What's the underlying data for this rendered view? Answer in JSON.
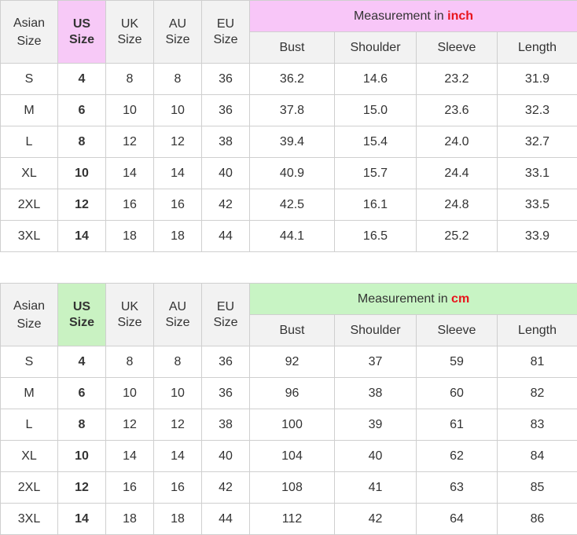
{
  "inch_table": {
    "header": {
      "asian_size": [
        "Asian",
        "Size"
      ],
      "us_size": [
        "US",
        "Size"
      ],
      "uk_size": [
        "UK",
        "Size"
      ],
      "au_size": [
        "AU",
        "Size"
      ],
      "eu_size": [
        "EU",
        "Size"
      ],
      "measurement_prefix": "Measurement in ",
      "measurement_unit": "inch",
      "columns": [
        "Bust",
        "Shoulder",
        "Sleeve",
        "Length"
      ]
    },
    "rows": [
      [
        "S",
        "4",
        "8",
        "8",
        "36",
        "36.2",
        "14.6",
        "23.2",
        "31.9"
      ],
      [
        "M",
        "6",
        "10",
        "10",
        "36",
        "37.8",
        "15.0",
        "23.6",
        "32.3"
      ],
      [
        "L",
        "8",
        "12",
        "12",
        "38",
        "39.4",
        "15.4",
        "24.0",
        "32.7"
      ],
      [
        "XL",
        "10",
        "14",
        "14",
        "40",
        "40.9",
        "15.7",
        "24.4",
        "33.1"
      ],
      [
        "2XL",
        "12",
        "16",
        "16",
        "42",
        "42.5",
        "16.1",
        "24.8",
        "33.5"
      ],
      [
        "3XL",
        "14",
        "18",
        "18",
        "44",
        "44.1",
        "16.5",
        "25.2",
        "33.9"
      ]
    ],
    "accent_color": "#f7c9f7"
  },
  "cm_table": {
    "header": {
      "asian_size": [
        "Asian",
        "Size"
      ],
      "us_size": [
        "US",
        "Size"
      ],
      "uk_size": [
        "UK",
        "Size"
      ],
      "au_size": [
        "AU",
        "Size"
      ],
      "eu_size": [
        "EU",
        "Size"
      ],
      "measurement_prefix": "Measurement in ",
      "measurement_unit": "cm",
      "columns": [
        "Bust",
        "Shoulder",
        "Sleeve",
        "Length"
      ]
    },
    "rows": [
      [
        "S",
        "4",
        "8",
        "8",
        "36",
        "92",
        "37",
        "59",
        "81"
      ],
      [
        "M",
        "6",
        "10",
        "10",
        "36",
        "96",
        "38",
        "60",
        "82"
      ],
      [
        "L",
        "8",
        "12",
        "12",
        "38",
        "100",
        "39",
        "61",
        "83"
      ],
      [
        "XL",
        "10",
        "14",
        "14",
        "40",
        "104",
        "40",
        "62",
        "84"
      ],
      [
        "2XL",
        "12",
        "16",
        "16",
        "42",
        "108",
        "41",
        "63",
        "85"
      ],
      [
        "3XL",
        "14",
        "18",
        "18",
        "44",
        "112",
        "42",
        "64",
        "86"
      ]
    ],
    "accent_color": "#c9f2c2"
  },
  "unit_highlight_color": "#e8141c"
}
